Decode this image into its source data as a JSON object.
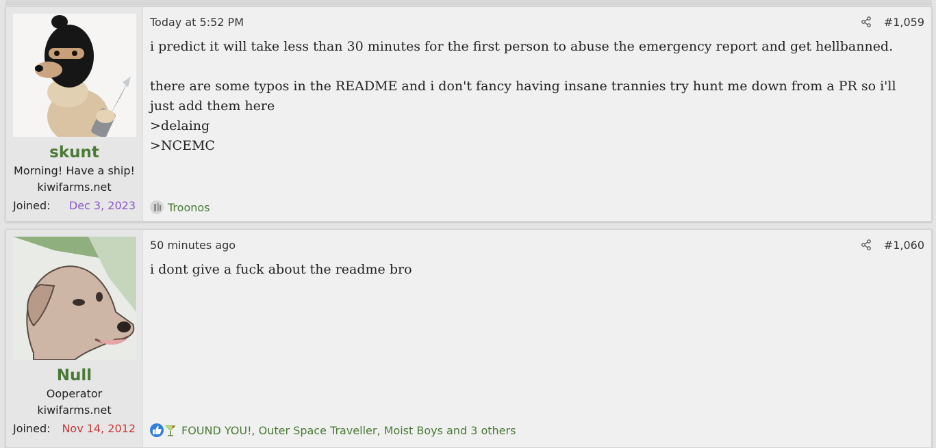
{
  "posts": [
    {
      "username": "skunt",
      "user_title": "Morning! Have a ship!",
      "user_site": "kiwifarms.net",
      "joined_label": "Joined:",
      "joined_date": "Dec 3, 2023",
      "joined_color": "#8b55c9",
      "timestamp": "Today at 5:52 PM",
      "post_number": "#1,059",
      "message": {
        "line1": "i predict it will take less than 30 minutes for the first person to abuse the emergency report and get hellbanned.",
        "line2": "there are some typos in the README and i don't fancy having insane trannies try hunt me down from a PR so i'll just add them here",
        "line3": ">delaing",
        "line4": ">NCEMC"
      },
      "reactions": {
        "icons": [
          "troon-reaction-icon"
        ],
        "text": "Troonos"
      }
    },
    {
      "username": "Null",
      "user_title": "Ooperator",
      "user_site": "kiwifarms.net",
      "joined_label": "Joined:",
      "joined_date": "Nov 14, 2012",
      "joined_color": "#cc3333",
      "timestamp": "50 minutes ago",
      "post_number": "#1,060",
      "message": {
        "line1": "i dont give a fuck about the readme bro"
      },
      "reactions": {
        "icons": [
          "like-icon",
          "cocktail-icon"
        ],
        "text": "FOUND YOU!, Outer Space Traveller, Moist Boys and 3 others"
      }
    }
  ],
  "colors": {
    "username": "#4a7a36",
    "link": "#4a7a36",
    "background": "#e4e4e4",
    "post_bg": "#f0f0f0"
  }
}
